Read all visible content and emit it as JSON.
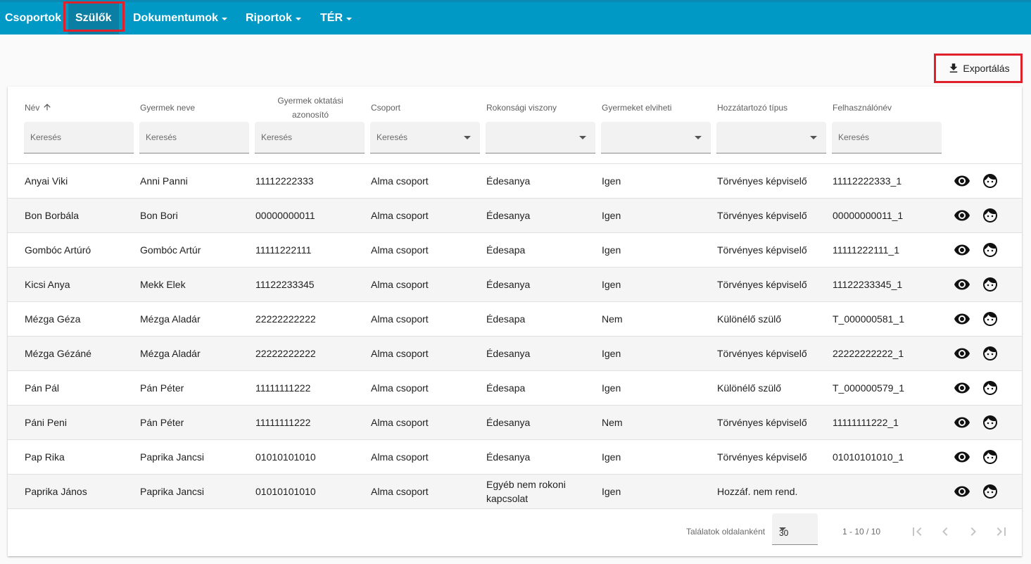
{
  "nav": {
    "items": [
      {
        "label": "Csoportok",
        "dropdown": false
      },
      {
        "label": "Szülők",
        "dropdown": false,
        "active": true
      },
      {
        "label": "Dokumentumok",
        "dropdown": true
      },
      {
        "label": "Riportok",
        "dropdown": true
      },
      {
        "label": "TÉR",
        "dropdown": true
      }
    ]
  },
  "toolbar": {
    "export_label": "Exportálás",
    "export_icon": "download-icon"
  },
  "table": {
    "columns": [
      {
        "label": "Név",
        "sorted": "asc",
        "filter_type": "text",
        "filter_placeholder": "Keresés"
      },
      {
        "label": "Gyermek neve",
        "filter_type": "text",
        "filter_placeholder": "Keresés"
      },
      {
        "label": "Gyermek oktatási azonosító",
        "filter_type": "text",
        "filter_placeholder": "Keresés"
      },
      {
        "label": "Csoport",
        "filter_type": "select",
        "filter_placeholder": "Keresés"
      },
      {
        "label": "Rokonsági viszony",
        "filter_type": "select",
        "filter_placeholder": ""
      },
      {
        "label": "Gyermeket elviheti",
        "filter_type": "select",
        "filter_placeholder": ""
      },
      {
        "label": "Hozzátartozó típus",
        "filter_type": "select",
        "filter_placeholder": ""
      },
      {
        "label": "Felhasználónév",
        "filter_type": "text",
        "filter_placeholder": "Keresés"
      }
    ],
    "rows": [
      [
        "Anyai Viki",
        "Anni Panni",
        "11112222333",
        "Alma csoport",
        "Édesanya",
        "Igen",
        "Törvényes képviselő",
        "11112222333_1"
      ],
      [
        "Bon Borbála",
        "Bon Bori",
        "00000000011",
        "Alma csoport",
        "Édesanya",
        "Igen",
        "Törvényes képviselő",
        "00000000011_1"
      ],
      [
        "Gombóc Artúró",
        "Gombóc Artúr",
        "11111222111",
        "Alma csoport",
        "Édesapa",
        "Igen",
        "Törvényes képviselő",
        "11111222111_1"
      ],
      [
        "Kicsi Anya",
        "Mekk Elek",
        "11122233345",
        "Alma csoport",
        "Édesanya",
        "Igen",
        "Törvényes képviselő",
        "11122233345_1"
      ],
      [
        "Mézga Géza",
        "Mézga Aladár",
        "22222222222",
        "Alma csoport",
        "Édesapa",
        "Nem",
        "Különélő szülő",
        "T_000000581_1"
      ],
      [
        "Mézga Gézáné",
        "Mézga Aladár",
        "22222222222",
        "Alma csoport",
        "Édesanya",
        "Igen",
        "Törvényes képviselő",
        "22222222222_1"
      ],
      [
        "Pán Pál",
        "Pán Péter",
        "11111111222",
        "Alma csoport",
        "Édesapa",
        "Igen",
        "Különélő szülő",
        "T_000000579_1"
      ],
      [
        "Páni Peni",
        "Pán Péter",
        "11111111222",
        "Alma csoport",
        "Édesanya",
        "Nem",
        "Törvényes képviselő",
        "11111111222_1"
      ],
      [
        "Pap Rika",
        "Paprika Jancsi",
        "01010101010",
        "Alma csoport",
        "Édesanya",
        "Igen",
        "Törvényes képviselő",
        "01010101010_1"
      ],
      [
        "Paprika János",
        "Paprika Jancsi",
        "01010101010",
        "Alma csoport",
        "Egyéb nem rokoni kapcsolat",
        "Igen",
        "Hozzáf. nem rend.",
        ""
      ]
    ],
    "row_actions": [
      "eye-icon",
      "face-icon"
    ]
  },
  "pagination": {
    "per_page_label": "Találatok oldalanként",
    "per_page_value": "30",
    "range_label": "1 - 10 / 10"
  }
}
